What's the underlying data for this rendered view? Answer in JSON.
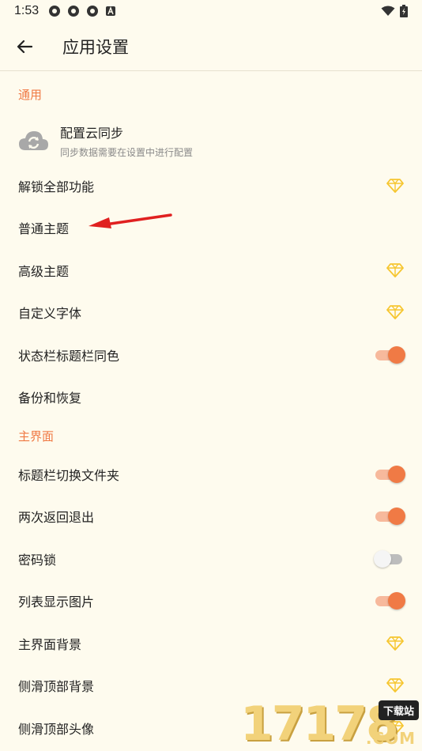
{
  "status": {
    "time": "1:53",
    "icons": [
      "app-notification-icon",
      "app-notification-icon",
      "app-notification-icon",
      "a-notification-icon"
    ],
    "right_icons": [
      "wifi-icon",
      "battery-icon"
    ]
  },
  "appbar": {
    "title": "应用设置",
    "back_icon": "back-arrow-icon"
  },
  "sections": [
    {
      "header": "通用",
      "rows": [
        {
          "label": "配置云同步",
          "sub": "同步数据需要在设置中进行配置",
          "type": "cloud"
        },
        {
          "label": "解锁全部功能",
          "type": "gem"
        },
        {
          "label": "普通主题",
          "type": "none"
        },
        {
          "label": "高级主题",
          "type": "gem"
        },
        {
          "label": "自定义字体",
          "type": "gem"
        },
        {
          "label": "状态栏标题栏同色",
          "type": "toggle",
          "on": true
        },
        {
          "label": "备份和恢复",
          "type": "none"
        }
      ]
    },
    {
      "header": "主界面",
      "rows": [
        {
          "label": "标题栏切换文件夹",
          "type": "toggle",
          "on": true
        },
        {
          "label": "两次返回退出",
          "type": "toggle",
          "on": true
        },
        {
          "label": "密码锁",
          "type": "toggle",
          "on": false
        },
        {
          "label": "列表显示图片",
          "type": "toggle",
          "on": true
        },
        {
          "label": "主界面背景",
          "type": "gem"
        },
        {
          "label": "侧滑顶部背景",
          "type": "gem"
        },
        {
          "label": "侧滑顶部头像",
          "type": "gem"
        }
      ]
    }
  ],
  "watermark": {
    "digits": "17178",
    "tag": "下载站",
    "suffix": ".COM"
  },
  "colors": {
    "background": "#fefbee",
    "accent": "#f07a45",
    "gem": "#f6c630",
    "annotation_arrow": "#e02020"
  }
}
